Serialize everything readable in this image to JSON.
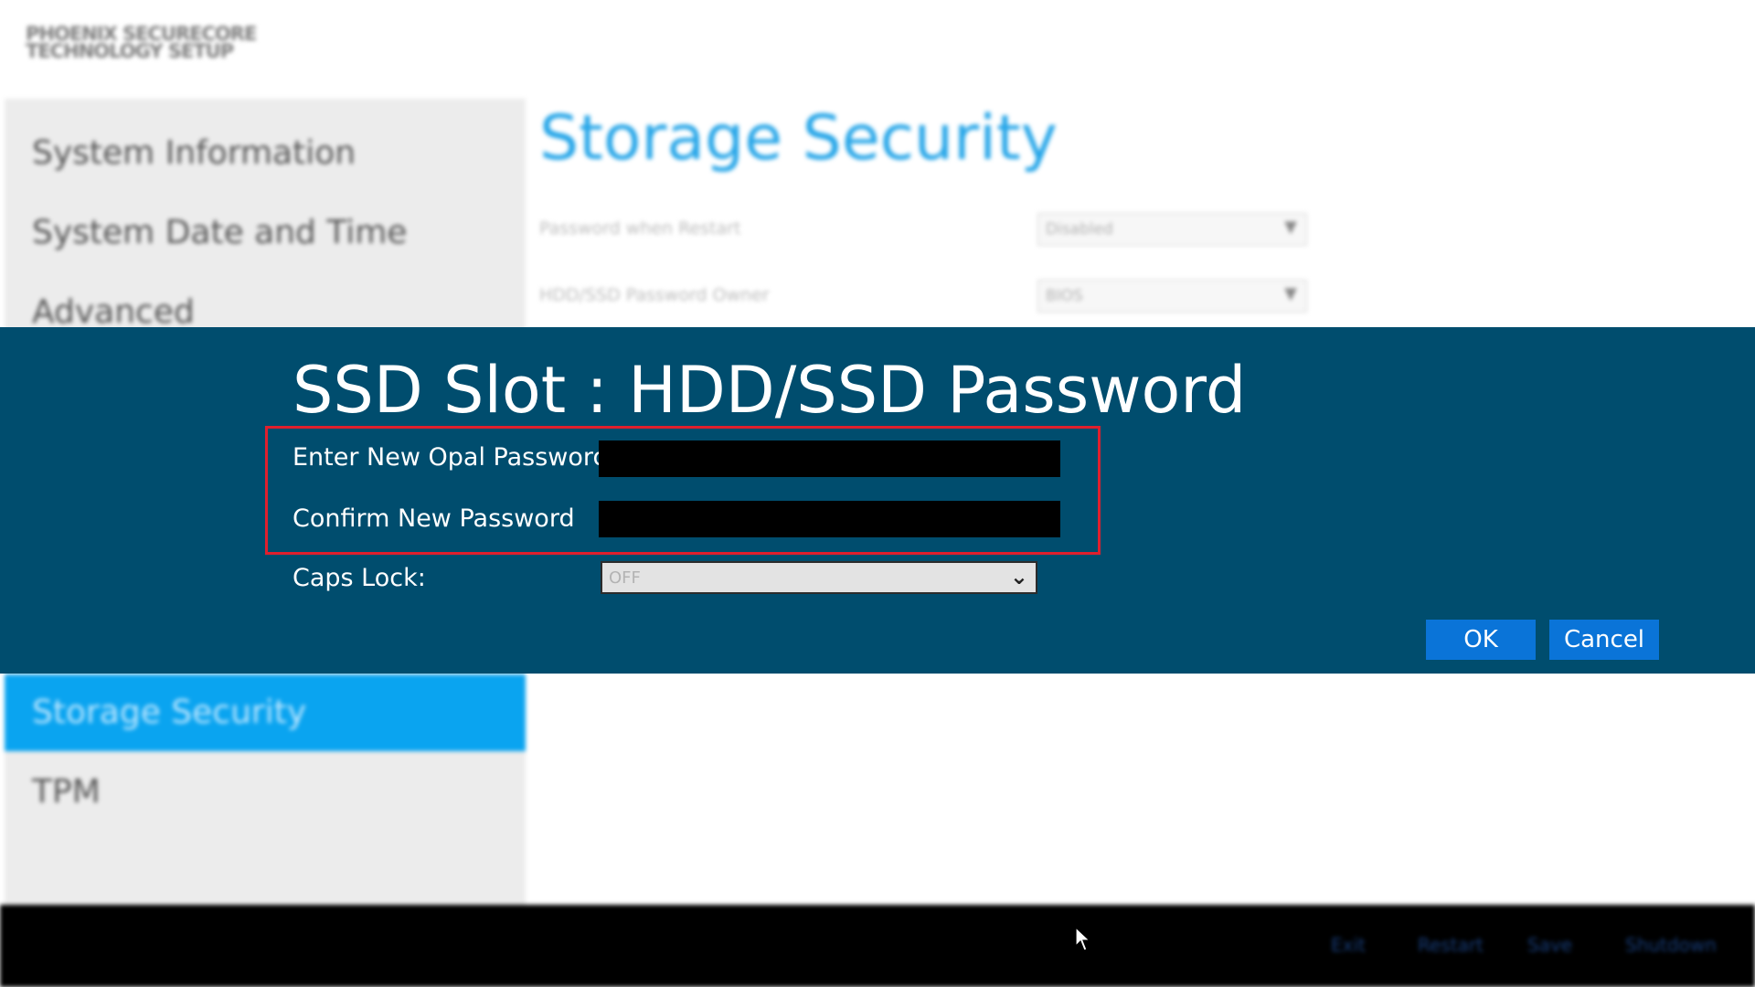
{
  "brand": {
    "line1": "PHOENIX SECURECORE",
    "line2": "TECHNOLOGY SETUP"
  },
  "sidebar": {
    "items": [
      {
        "label": "System Information",
        "active": false
      },
      {
        "label": "System Date and Time",
        "active": false
      },
      {
        "label": "Advanced",
        "active": false
      },
      {
        "label": "Storage Security",
        "active": true
      },
      {
        "label": "TPM",
        "active": false
      }
    ]
  },
  "page": {
    "title": "Storage Security",
    "rows": [
      {
        "label": "Password when Restart",
        "value": "Disabled"
      },
      {
        "label": "HDD/SSD Password Owner",
        "value": "BIOS"
      }
    ]
  },
  "dialog": {
    "title": "SSD Slot : HDD/SSD Password",
    "new_password_label": "Enter New Opal Password",
    "confirm_password_label": "Confirm New Password",
    "new_password_value": "",
    "confirm_password_value": "",
    "caps_lock_label": "Caps Lock:",
    "caps_lock_value": "OFF",
    "ok_label": "OK",
    "cancel_label": "Cancel"
  },
  "footer": {
    "links": [
      "Exit",
      "Restart",
      "Save",
      "Shutdown"
    ]
  },
  "colors": {
    "dialog_bg": "#004d6e",
    "accent": "#0aa4f0",
    "highlight_border": "#e01f2d",
    "button_bg": "#0a74d8"
  },
  "icons": {
    "dropdown": "chevron-down-icon",
    "pointer": "mouse-cursor-icon"
  }
}
